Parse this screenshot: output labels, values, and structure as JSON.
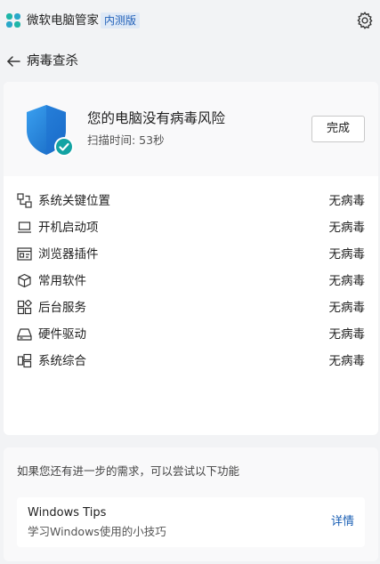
{
  "app": {
    "title": "微软电脑管家",
    "badge": "内测版",
    "icons": {
      "logo": "pc-manager-logo",
      "settings": "gear-icon"
    }
  },
  "nav": {
    "back_icon": "arrow-left-icon",
    "title": "病毒查杀"
  },
  "result": {
    "icon": "shield-check-icon",
    "title": "您的电脑没有病毒风险",
    "scan_time": "扫描时间: 53秒",
    "done_label": "完成"
  },
  "scan_items": [
    {
      "label": "系统关键位置",
      "status": "无病毒",
      "icon": "system-key-location-icon"
    },
    {
      "label": "开机启动项",
      "status": "无病毒",
      "icon": "laptop-icon"
    },
    {
      "label": "浏览器插件",
      "status": "无病毒",
      "icon": "browser-extension-icon"
    },
    {
      "label": "常用软件",
      "status": "无病毒",
      "icon": "package-box-icon"
    },
    {
      "label": "后台服务",
      "status": "无病毒",
      "icon": "apps-grid-icon"
    },
    {
      "label": "硬件驱动",
      "status": "无病毒",
      "icon": "hard-drive-icon"
    },
    {
      "label": "系统综合",
      "status": "无病毒",
      "icon": "system-overview-icon"
    }
  ],
  "more": {
    "hint": "如果您还有进一步的需求，可以尝试以下功能",
    "tip": {
      "title": "Windows Tips",
      "desc": "学习Windows使用的小技巧",
      "link": "详情"
    }
  },
  "colors": {
    "shield_blue": "#1e88e5",
    "check_teal": "#12a3a3",
    "link_blue": "#1a5fb4"
  }
}
